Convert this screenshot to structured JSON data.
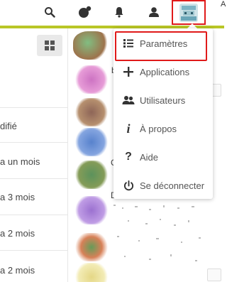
{
  "header": {
    "icons": [
      "search-icon",
      "activity-icon",
      "notifications-icon",
      "contacts-icon"
    ],
    "edge_char": "A",
    "accent_color": "#b9c626"
  },
  "left_list": {
    "items": [
      "difié",
      "a un mois",
      "a 3 mois",
      "a 2 mois",
      "a 2 mois"
    ]
  },
  "peek_letters": [
    "b",
    "C",
    "D"
  ],
  "menu": {
    "items": [
      {
        "icon": "settings-list-icon",
        "label": "Paramètres"
      },
      {
        "icon": "plus-icon",
        "label": "Applications"
      },
      {
        "icon": "users-icon",
        "label": "Utilisateurs"
      },
      {
        "icon": "info-icon",
        "label": "À propos"
      },
      {
        "icon": "help-icon",
        "label": "Aide"
      },
      {
        "icon": "power-icon",
        "label": "Se déconnecter"
      }
    ]
  },
  "highlight_color": "#e01a1a"
}
